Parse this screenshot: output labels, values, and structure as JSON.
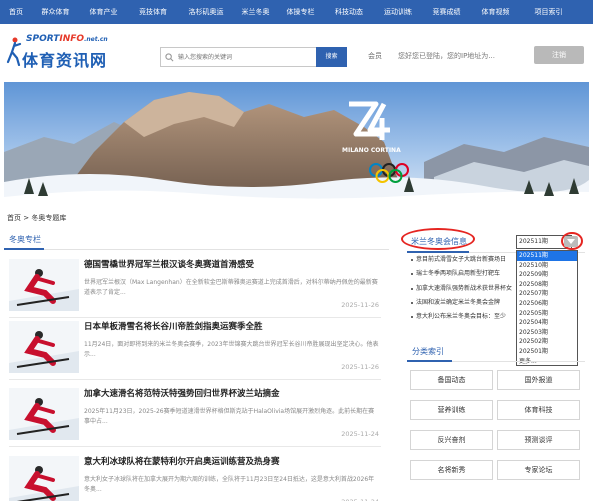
{
  "nav": [
    "首页",
    "群众体育",
    "体育产业",
    "竞技体育",
    "洛杉矶奥运",
    "米兰冬奥",
    "体操专栏",
    "科技动态",
    "运动训练",
    "竞赛成绩",
    "体育视频",
    "项目索引"
  ],
  "logo": {
    "en_sport": "SPORT",
    "en_info": "INFO",
    "en_domain": ".net.cn",
    "cn": "体育资讯网"
  },
  "search": {
    "placeholder": "输入您搜索的关键词",
    "button": "搜索"
  },
  "member": {
    "label": "会员",
    "message": "您好您已登陆，您的IP地址为..."
  },
  "register_button": "注销",
  "banner": {
    "emblem_text": "MILANO CORTINA",
    "emblem_number": "26"
  },
  "breadcrumb": "首页 > 冬奥专题库",
  "left_section_title": "冬奥专栏",
  "articles": [
    {
      "title": "德国雪橇世界冠军兰根汉谈冬奥赛道首滑感受",
      "desc": "世界冠军兰根汉（Max Langenhan）在全新软金巴斯蒂雅奥运赛道上完成首滑后，对科尔蒂纳丹佩佐的最新赛道表示了肯定...",
      "date": "2025-11-26"
    },
    {
      "title": "日本单板滑雪名将长谷川帝胜剑指奥运赛季全胜",
      "desc": "11月24日，面对即将到来的米兰冬奥会赛季，2023年世锦赛大跳台世界冠军长谷川帝胜展现出坚定决心。他表示...",
      "date": "2025-11-26"
    },
    {
      "title": "加拿大速滑名将范特沃特强势回归世界杯波兰站摘金",
      "desc": "2025年11月23日，2025-26赛季短道速滑世界杯格但斯克站于HalaOlivia场馆展开激烈角逐。此前长期在赛事中占...",
      "date": "2025-11-24"
    },
    {
      "title": "意大利冰球队将在蒙特利尔开启奥运训练营及热身赛",
      "desc": "意大利女子冰球队将在加拿大展开为期六周的训练，全队将于11月23日至24日抵达，这是意大利首战2026年冬奥...",
      "date": "2025-11-24"
    }
  ],
  "right_section_title": "米兰冬奥会信息",
  "issue_select": {
    "selected": "202511期",
    "options": [
      "202511期",
      "202510期",
      "202509期",
      "202508期",
      "202507期",
      "202506期",
      "202505期",
      "202504期",
      "202503期",
      "202502期",
      "202501期",
      "更多..."
    ]
  },
  "news": [
    "意目前式滑雪女子大跳台新赛场日",
    "瑞士冬季两项队启用新型打靶车",
    "加拿大速滑队强势新战术获世界杯女",
    "法国和波兰确定米兰冬奥会金牌",
    "意大利公布米兰冬奥会目标：至少"
  ],
  "category_title": "分类索引",
  "categories": [
    "备国动态",
    "国外报道",
    "营养训练",
    "体育科技",
    "反兴奋剂",
    "预测谈评",
    "名将新秀",
    "专家论坛"
  ],
  "colors": {
    "nav_bg": "#2f62b0",
    "accent": "#2f62b0",
    "highlight_circle": "#e52521",
    "selected_option": "#1e74e6"
  }
}
